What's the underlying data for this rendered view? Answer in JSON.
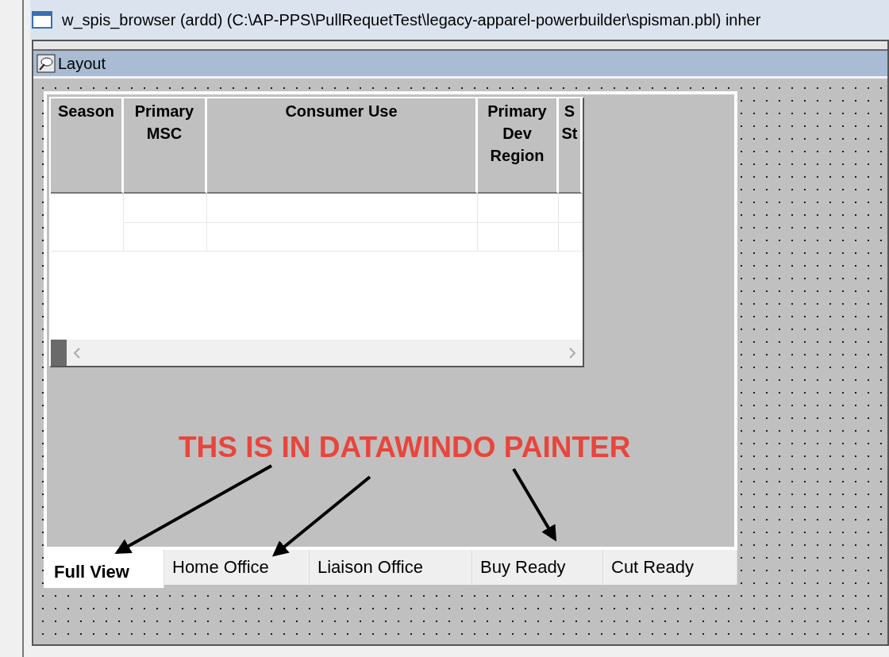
{
  "window": {
    "title": "w_spis_browser (ardd) (C:\\AP-PPS\\PullRequetTest\\legacy-apparel-powerbuilder\\spisman.pbl) inher"
  },
  "pane": {
    "title": "Layout"
  },
  "table": {
    "columns": [
      {
        "lines": [
          "Season"
        ]
      },
      {
        "lines": [
          "Primary",
          "MSC"
        ]
      },
      {
        "lines": [
          "Consumer Use"
        ]
      },
      {
        "lines": [
          "Primary",
          "Dev",
          "Region"
        ]
      },
      {
        "lines": [
          "S",
          "St"
        ]
      }
    ]
  },
  "annotation": {
    "text": "THS IS IN DATAWINDO PAINTER"
  },
  "tabs": [
    {
      "label": "Full View",
      "selected": true
    },
    {
      "label": "Home Office",
      "selected": false
    },
    {
      "label": "Liaison Office",
      "selected": false
    },
    {
      "label": "Buy Ready",
      "selected": false
    },
    {
      "label": "Cut Ready",
      "selected": false
    }
  ]
}
